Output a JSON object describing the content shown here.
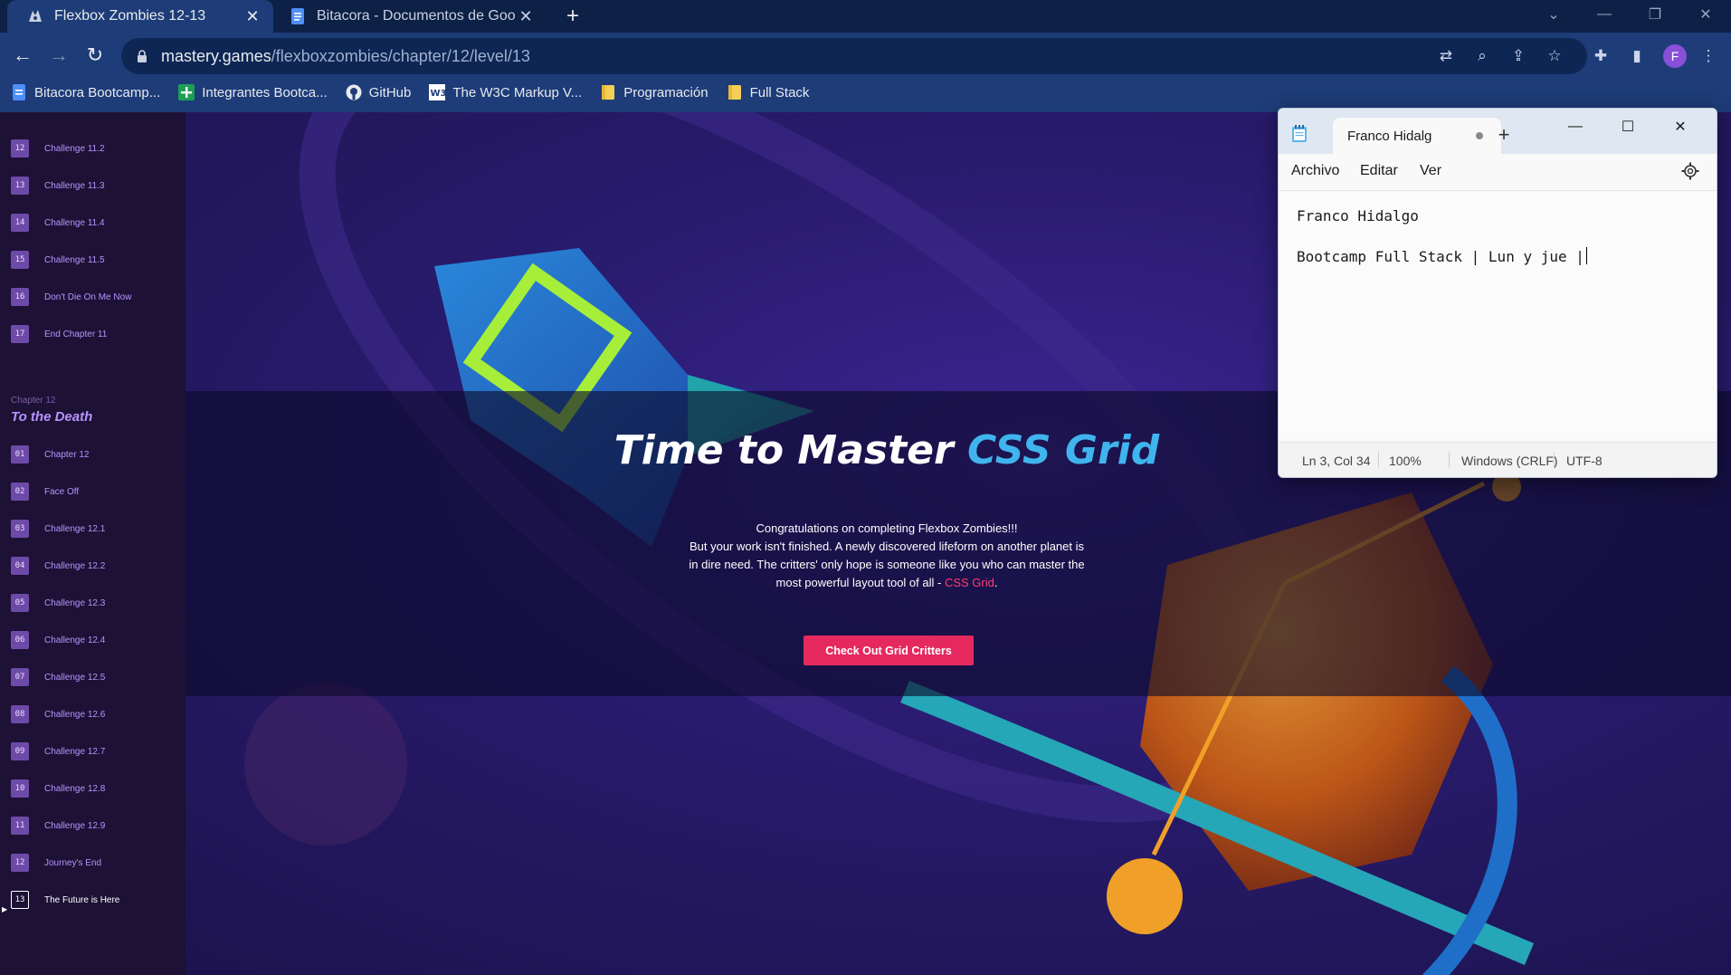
{
  "browser": {
    "tabs": [
      {
        "title": "Flexbox Zombies 12-13",
        "active": true
      },
      {
        "title": "Bitacora - Documentos de Googl",
        "active": false
      }
    ],
    "address": {
      "host": "mastery.games",
      "path": "/flexboxzombies/chapter/12/level/13"
    },
    "bookmarks": [
      {
        "label": "Bitacora Bootcamp...",
        "icon": "docs-icon"
      },
      {
        "label": "Integrantes Bootca...",
        "icon": "sheets-plus-icon"
      },
      {
        "label": "GitHub",
        "icon": "github-icon"
      },
      {
        "label": "The W3C Markup V...",
        "icon": "w3c-icon"
      },
      {
        "label": "Programación",
        "icon": "folder-icon"
      },
      {
        "label": "Full Stack",
        "icon": "folder-icon"
      }
    ],
    "profile_initial": "F"
  },
  "sidebar": {
    "chapter11_items": [
      {
        "num": "12",
        "label": "Challenge 11.2"
      },
      {
        "num": "13",
        "label": "Challenge 11.3"
      },
      {
        "num": "14",
        "label": "Challenge 11.4"
      },
      {
        "num": "15",
        "label": "Challenge 11.5"
      },
      {
        "num": "16",
        "label": "Don't Die On Me Now"
      },
      {
        "num": "17",
        "label": "End Chapter 11"
      }
    ],
    "chapter12_small": "Chapter 12",
    "chapter12_title": "To the Death",
    "chapter12_items": [
      {
        "num": "01",
        "label": "Chapter 12"
      },
      {
        "num": "02",
        "label": "Face Off"
      },
      {
        "num": "03",
        "label": "Challenge 12.1"
      },
      {
        "num": "04",
        "label": "Challenge 12.2"
      },
      {
        "num": "05",
        "label": "Challenge 12.3"
      },
      {
        "num": "06",
        "label": "Challenge 12.4"
      },
      {
        "num": "07",
        "label": "Challenge 12.5"
      },
      {
        "num": "08",
        "label": "Challenge 12.6"
      },
      {
        "num": "09",
        "label": "Challenge 12.7"
      },
      {
        "num": "10",
        "label": "Challenge 12.8"
      },
      {
        "num": "11",
        "label": "Challenge 12.9"
      },
      {
        "num": "12",
        "label": "Journey's End"
      },
      {
        "num": "13",
        "label": "The Future is Here"
      }
    ]
  },
  "hero": {
    "title_main": "Time to Master ",
    "title_accent": "CSS Grid",
    "line1": "Congratulations on completing Flexbox Zombies!!!",
    "line2": "But your work isn't finished. A newly discovered lifeform on another planet is in dire need. The critters' only hope is someone like you who can master the most powerful layout tool of all - ",
    "link": "CSS Grid",
    "period": ".",
    "cta": "Check Out Grid Critters"
  },
  "notepad": {
    "tab_title": "Franco Hidalg",
    "menu": [
      "Archivo",
      "Editar",
      "Ver"
    ],
    "lines": [
      "Franco Hidalgo",
      "",
      "Bootcamp Full Stack | Lun y jue |"
    ],
    "status": {
      "position": "Ln 3, Col 34",
      "zoom": "100%",
      "eol": "Windows (CRLF)",
      "encoding": "UTF-8"
    }
  },
  "colors": {
    "accent_pink": "#e5295f",
    "accent_blue": "#40b4ec",
    "sidebar_purple": "#b794ff"
  }
}
